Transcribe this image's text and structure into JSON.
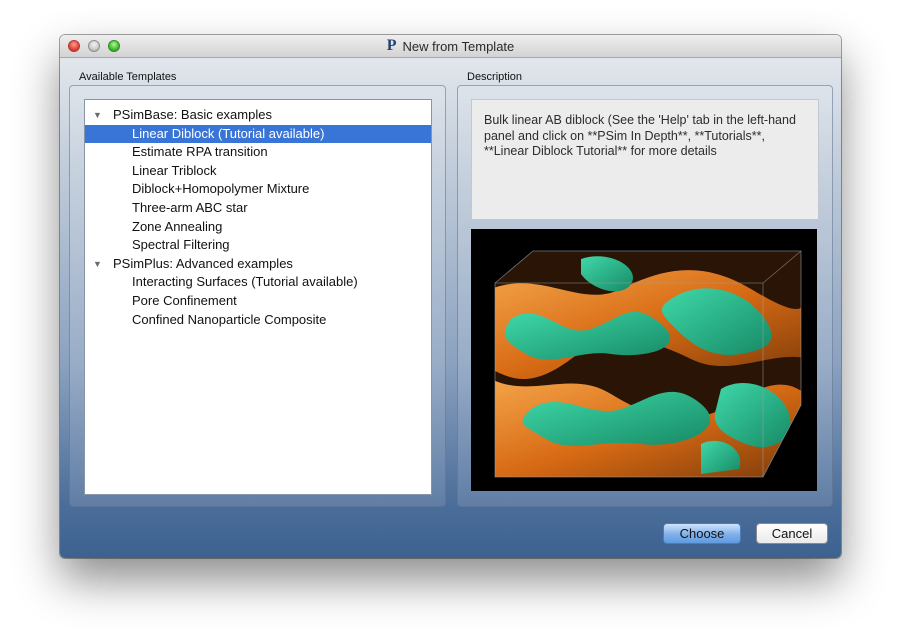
{
  "window": {
    "title": "New from Template",
    "app_icon_glyph": "P"
  },
  "left_panel": {
    "label": "Available Templates"
  },
  "right_panel": {
    "label": "Description"
  },
  "tree": {
    "groups": [
      {
        "label": "PSimBase: Basic examples",
        "items": [
          "Linear Diblock (Tutorial available)",
          "Estimate RPA transition",
          "Linear Triblock",
          "Diblock+Homopolymer Mixture",
          "Three-arm ABC star",
          "Zone Annealing",
          "Spectral Filtering"
        ]
      },
      {
        "label": "PSimPlus: Advanced examples",
        "items": [
          "Interacting Surfaces (Tutorial available)",
          "Pore Confinement",
          "Confined Nanoparticle Composite"
        ]
      }
    ],
    "selected_item": "Linear Diblock (Tutorial available)"
  },
  "description": "Bulk linear AB diblock (See the 'Help' tab in the left-hand panel and click on **PSim In Depth**, **Tutorials**, **Linear Diblock Tutorial** for more details",
  "buttons": {
    "choose": "Choose",
    "cancel": "Cancel"
  },
  "colors": {
    "selection": "#3875d7",
    "accent_orange": "#e0781c",
    "accent_green": "#2fbf8c"
  },
  "icons": [
    "close-light",
    "minimize-light",
    "zoom-light",
    "disclosure-triangle",
    "psim-app-icon"
  ]
}
